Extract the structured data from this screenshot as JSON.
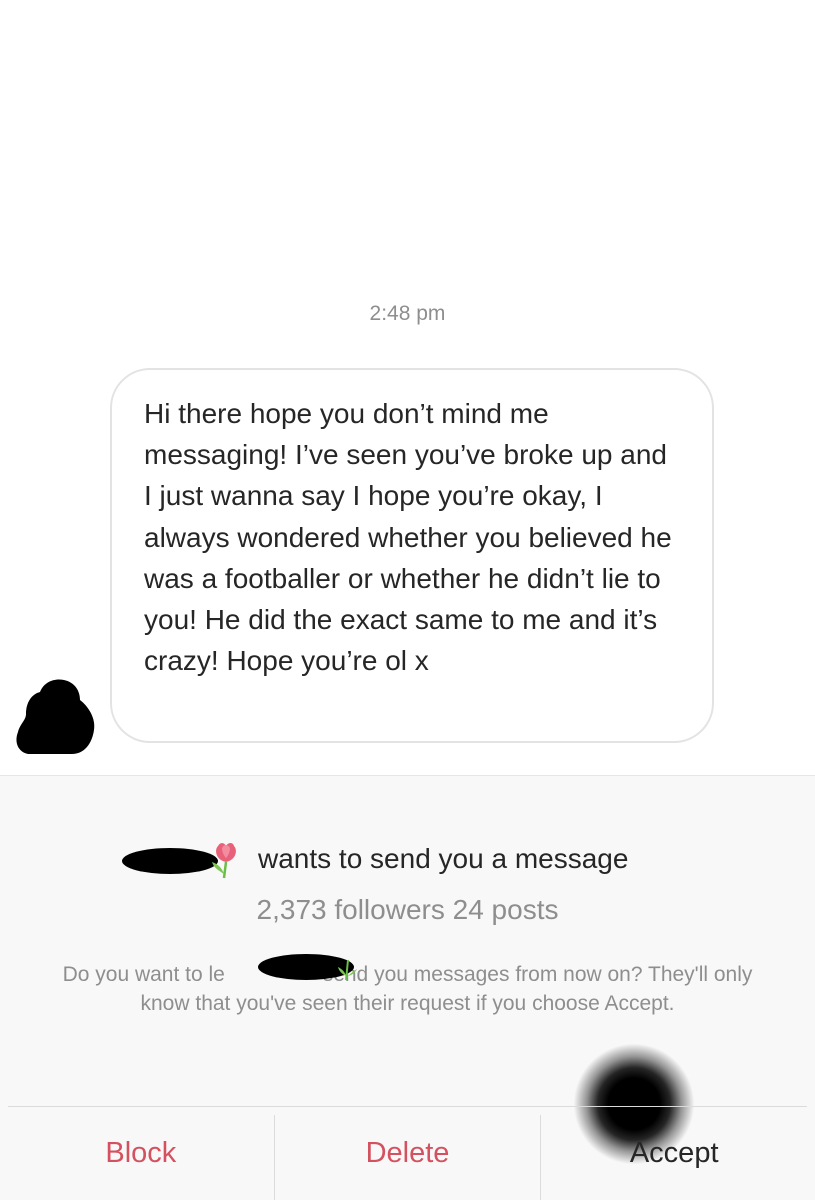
{
  "conversation": {
    "timestamp": "2:48 pm",
    "message": "Hi there hope you don’t mind me messaging! I’ve seen you’ve broke up and I just wanna say I hope you’re okay, I always wondered whether you believed he was a footballer or whether he didn’t lie to you! He did the exact same to me and it’s crazy! Hope you’re ol x"
  },
  "request": {
    "title": "wants to send you a message",
    "stats": "2,373 followers 24 posts",
    "explain_before": "Do you want to le",
    "explain_after": "send you messages from now on? They'll only know that you've seen their request if you choose Accept."
  },
  "actions": {
    "block_label": "Block",
    "delete_label": "Delete",
    "accept_label": "Accept"
  },
  "colors": {
    "destructive": "#d4525f",
    "muted": "#8e8e8e",
    "text": "#262626"
  }
}
